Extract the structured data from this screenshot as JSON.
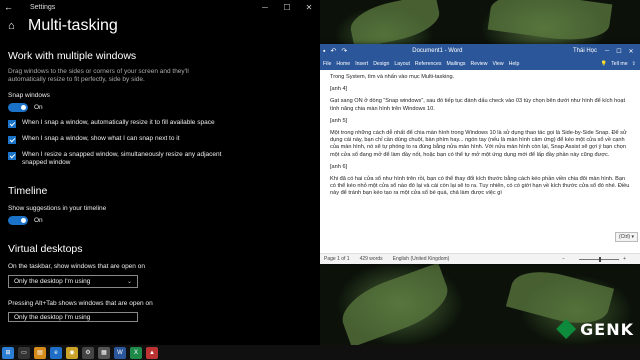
{
  "settings": {
    "app_title": "Settings",
    "page_title": "Multi-tasking",
    "section_snap": "Work with multiple windows",
    "snap_desc": "Drag windows to the sides or corners of your screen and they'll automatically resize to fit perfectly, side by side.",
    "snap_label": "Snap windows",
    "snap_state": "On",
    "checks": [
      "When I snap a window, automatically resize it to fill available space",
      "When I snap a window, show what I can snap next to it",
      "When I resize a snapped window, simultaneously resize any adjacent snapped window"
    ],
    "section_timeline": "Timeline",
    "timeline_label": "Show suggestions in your timeline",
    "timeline_state": "On",
    "section_vd": "Virtual desktops",
    "vd_taskbar_label": "On the taskbar, show windows that are open on",
    "vd_taskbar_value": "Only the desktop I'm using",
    "vd_alttab_label": "Pressing Alt+Tab shows windows that are open on",
    "vd_alttab_value": "Only the desktop I'm using"
  },
  "word": {
    "doc_title": "Document1 - Word",
    "user": "Thái Học",
    "tabs": [
      "File",
      "Home",
      "Insert",
      "Design",
      "Layout",
      "References",
      "Mailings",
      "Review",
      "View",
      "Help"
    ],
    "tell_me": "Tell me",
    "paragraphs": [
      "Trong System, tìm và nhấn vào mục Multi-tasking.",
      "[anh 4]",
      "Gạt sang ON ở dòng “Snap windows”, sau đó tiếp tục đánh dấu check vào 03 tùy chọn bên dưới như hình để kích hoạt tính năng chia màn hình trên Windows 10.",
      "[anh 5]",
      "Một trong những cách dễ nhất để chia màn hình trong Windows 10 là sử dụng thao tác gọi là Side-by-Side Snap. Để sử dụng cái này, bạn chỉ cần dùng chuột, bàn phím hay... ngón tay (nếu là màn hình cảm ứng) để kéo một cửa sổ về cạnh của màn hình, nó sẽ tự phóng to ra đúng bằng nửa màn hình. Với nửa màn hình còn lại, Snap Assist sẽ gợi ý bạn chọn một cửa sổ đang mở để làm đầy nốt, hoặc bạn có thể tự mở một ứng dụng mới để lấp đầy phần này cũng được.",
      "[anh 6]",
      "Khi đã có hai cửa sổ như hình trên rồi, bạn có thể thay đổi kích thước bằng cách kéo phần viền chia đôi màn hình. Bạn có thể kéo nhỏ một cửa sổ nào đó lại và cái còn lại sẽ to ra. Tuy nhiên, có có giới hạn về kích thước cửa sổ đó nhé. Điều này để tránh bạn kéo tạo ra một cửa sổ bé quá, chả làm được việc gì"
    ],
    "ctrl_tag": "(Ctrl) ▾",
    "status_page": "Page 1 of 1",
    "status_words": "429 words",
    "status_lang": "English (United Kingdom)",
    "zoom": "+"
  },
  "logo_text": "GENK",
  "colors": {
    "accent": "#1a73c8",
    "word_blue": "#2b579a",
    "logo_green": "#0e8a3c"
  }
}
